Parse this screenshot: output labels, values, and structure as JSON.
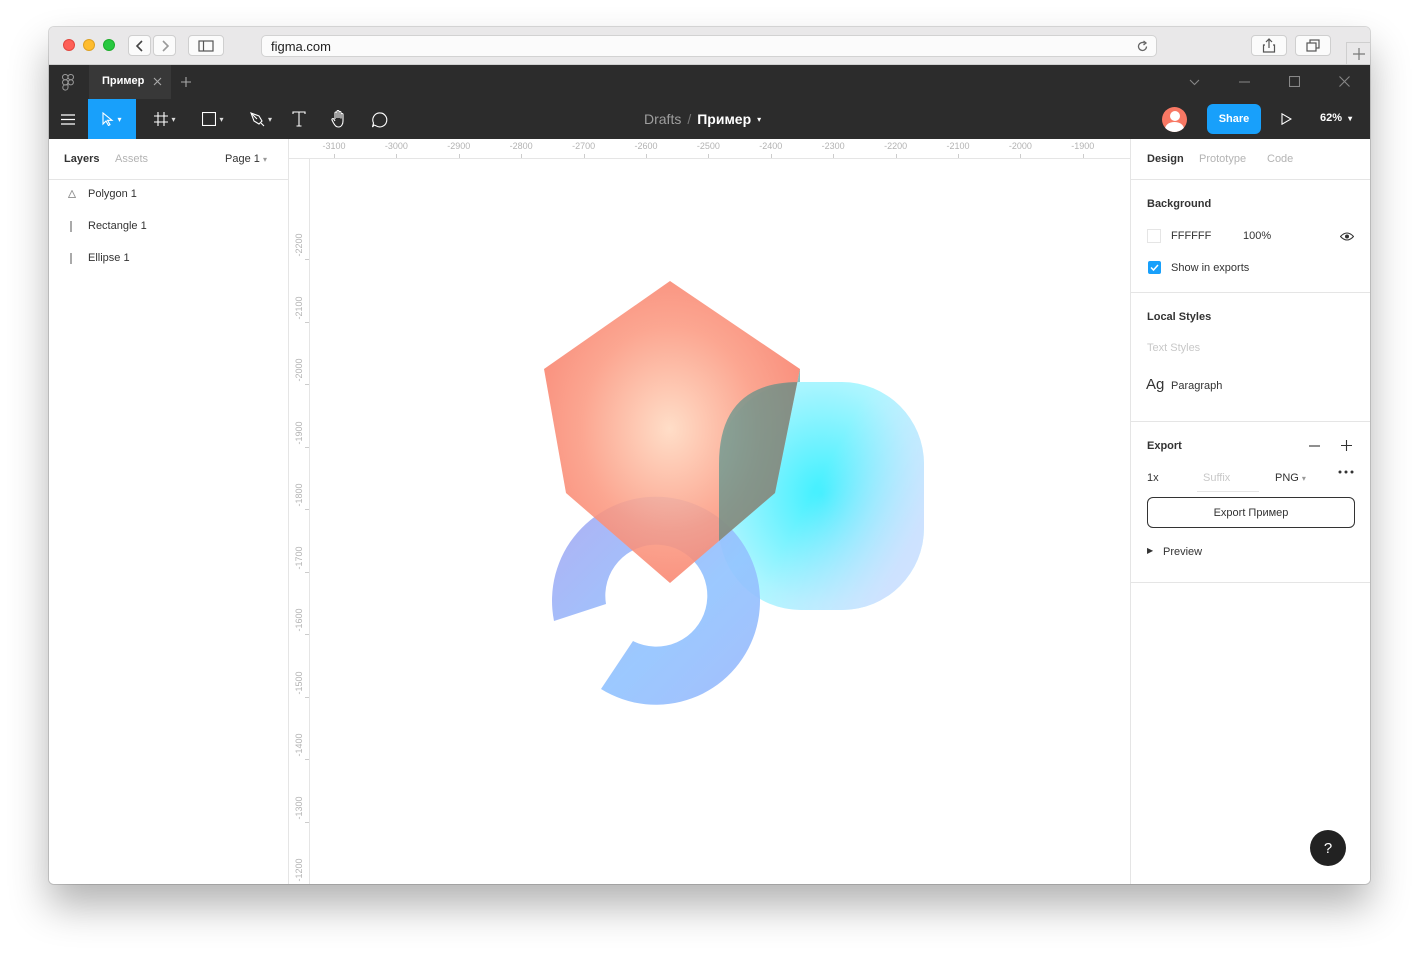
{
  "browser": {
    "url": "figma.com"
  },
  "figma": {
    "tab_title": "Пример",
    "breadcrumb": {
      "folder": "Drafts",
      "separator": "/",
      "file": "Пример"
    },
    "share_label": "Share",
    "zoom": "62%"
  },
  "left_panel": {
    "tabs": [
      "Layers",
      "Assets"
    ],
    "page": "Page 1",
    "layers": [
      {
        "name": "Polygon 1",
        "icon": "polygon-icon"
      },
      {
        "name": "Rectangle 1",
        "icon": "rectangle-layer-icon"
      },
      {
        "name": "Ellipse 1",
        "icon": "ellipse-layer-icon"
      }
    ]
  },
  "rulers": {
    "horizontal": [
      "-3100",
      "-3000",
      "-2900",
      "-2800",
      "-2700",
      "-2600",
      "-2500",
      "-2400",
      "-2300",
      "-2200",
      "-2100",
      "-2000",
      "-1900"
    ],
    "vertical": [
      "-2200",
      "-2100",
      "-2000",
      "-1900",
      "-1800",
      "-1700",
      "-1600",
      "-1500",
      "-1400",
      "-1300",
      "-1200"
    ]
  },
  "right_panel": {
    "tabs": [
      "Design",
      "Prototype",
      "Code"
    ],
    "background": {
      "title": "Background",
      "hex": "FFFFFF",
      "opacity": "100%",
      "show_in_exports": "Show in exports"
    },
    "local_styles": {
      "title": "Local Styles",
      "subtitle": "Text Styles",
      "sample": "Ag",
      "style_name": "Paragraph"
    },
    "export": {
      "title": "Export",
      "scale": "1x",
      "suffix_placeholder": "Suffix",
      "format": "PNG",
      "button": "Export Пример",
      "preview": "Preview"
    }
  },
  "help_label": "?",
  "colors": {
    "accent": "#18a0fb",
    "toolbar_bg": "#2c2c2c",
    "polygon_outer": "#f87864",
    "polygon_center": "#ffd9c0",
    "rectangle_center": "#3ff0ff",
    "ellipse_start": "#9fa6f8",
    "ellipse_end": "#93c4ff"
  }
}
